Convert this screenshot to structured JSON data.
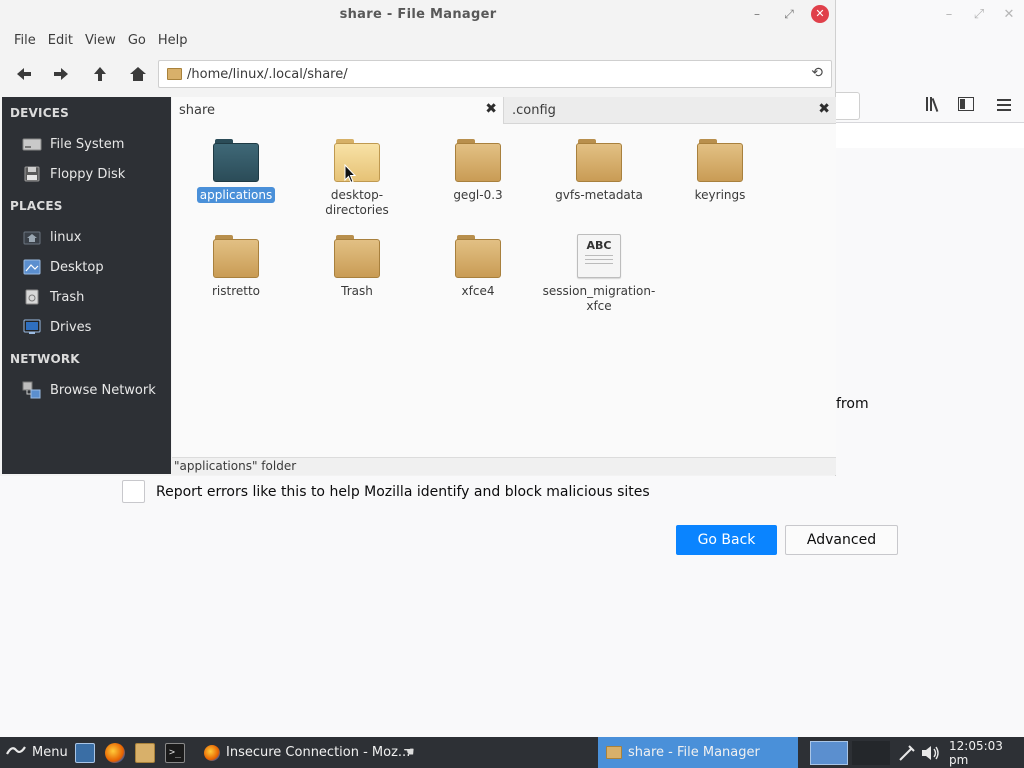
{
  "browser": {
    "partial_text": "from",
    "report_label": "Report errors like this to help Mozilla identify and block malicious sites",
    "go_back_label": "Go Back",
    "advanced_label": "Advanced",
    "window_controls": [
      "minimize-icon",
      "maximize-icon",
      "close-icon"
    ],
    "toolbar_icons": [
      "library-icon",
      "sidebar-icon",
      "hamburger-menu-icon"
    ]
  },
  "fm": {
    "title": "share - File Manager",
    "menu": [
      "File",
      "Edit",
      "View",
      "Go",
      "Help"
    ],
    "toolbar_icons": [
      "back-arrow-icon",
      "forward-arrow-icon",
      "up-arrow-icon",
      "home-icon"
    ],
    "address": "/home/linux/.local/share/",
    "sidebar": {
      "devices_heading": "DEVICES",
      "devices": [
        {
          "label": "File System",
          "icon": "hard-drive-icon"
        },
        {
          "label": "Floppy Disk",
          "icon": "floppy-disk-icon"
        }
      ],
      "places_heading": "PLACES",
      "places": [
        {
          "label": "linux",
          "icon": "home-icon"
        },
        {
          "label": "Desktop",
          "icon": "desktop-icon"
        },
        {
          "label": "Trash",
          "icon": "trash-icon"
        },
        {
          "label": "Drives",
          "icon": "drives-icon"
        }
      ],
      "network_heading": "NETWORK",
      "network": [
        {
          "label": "Browse Network",
          "icon": "network-icon"
        }
      ]
    },
    "tabs": [
      {
        "label": "share",
        "active": true
      },
      {
        "label": ".config",
        "active": false
      }
    ],
    "files": [
      {
        "name": "applications",
        "type": "folder-dark",
        "selected": true
      },
      {
        "name": "desktop-\ndirectories",
        "type": "folder-light",
        "selected": false
      },
      {
        "name": "gegl-0.3",
        "type": "folder",
        "selected": false
      },
      {
        "name": "gvfs-metadata",
        "type": "folder",
        "selected": false
      },
      {
        "name": "keyrings",
        "type": "folder",
        "selected": false
      },
      {
        "name": "ristretto",
        "type": "folder",
        "selected": false
      },
      {
        "name": "Trash",
        "type": "folder",
        "selected": false
      },
      {
        "name": "xfce4",
        "type": "folder",
        "selected": false
      },
      {
        "name": "session_migration-\nxfce",
        "type": "document",
        "doc_label": "ABC",
        "selected": false
      }
    ],
    "status": "\"applications\" folder"
  },
  "taskbar": {
    "menu_label": "Menu",
    "launchers": [
      "desktop-launcher-icon",
      "firefox-icon",
      "file-manager-icon",
      "terminal-icon"
    ],
    "tasks": [
      {
        "label": "Insecure Connection - Moz...",
        "icon": "firefox-icon",
        "active": false
      },
      {
        "label": "share - File Manager",
        "icon": "folder-icon",
        "active": true
      }
    ],
    "clock": "12:05:03 pm"
  },
  "colors": {
    "accent_blue": "#0a84ff",
    "selection_blue": "#4a90d9",
    "sidebar_bg": "#2d3035",
    "close_red": "#e0404a"
  }
}
